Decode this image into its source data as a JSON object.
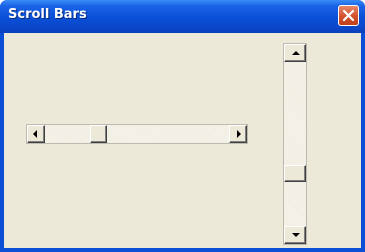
{
  "window": {
    "title": "Scroll Bars",
    "close_icon": "close-icon"
  },
  "horizontal_scrollbar": {
    "left_arrow_icon": "arrow-left-icon",
    "right_arrow_icon": "arrow-right-icon",
    "thumb_position": 0.27
  },
  "vertical_scrollbar": {
    "up_arrow_icon": "arrow-up-icon",
    "down_arrow_icon": "arrow-down-icon",
    "thumb_position": 0.7
  },
  "colors": {
    "title_bar": "#0a4fd6",
    "close_button": "#d2502c",
    "client_background": "#ece9d8"
  }
}
